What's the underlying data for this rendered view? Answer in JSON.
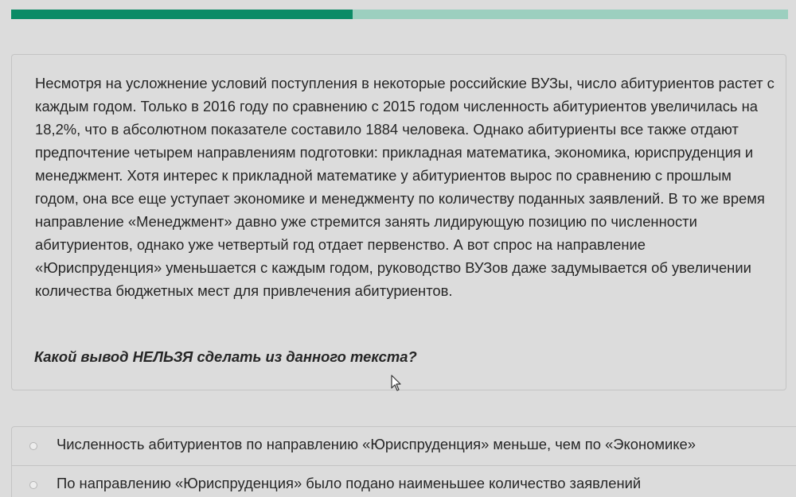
{
  "progress": {
    "fraction": 0.44,
    "fill_color": "#0b8b66",
    "track_color": "#9ccfbf"
  },
  "task": {
    "passage": "Несмотря на усложнение условий поступления в некоторые российские ВУЗы, число абитуриентов растет с каждым годом. Только в 2016 году по сравнению с 2015 годом численность абитуриентов увеличилась на 18,2%, что в абсолютном показателе составило 1884 человека. Однако абитуриенты все также отдают предпочтение четырем направлениям подготовки: прикладная математика, экономика, юриспруденция и менеджмент. Хотя интерес к прикладной математике у абитуриентов вырос по сравнению с прошлым годом, она все еще уступает экономике и менеджменту по количеству поданных заявлений. В то же время направление «Менеджмент» давно уже стремится занять лидирующую позицию по численности абитуриентов, однако уже четвертый год отдает первенство. А вот спрос на направление «Юриспруденция» уменьшается с каждым годом, руководство ВУЗов даже задумывается об увеличении количества бюджетных мест для привлечения абитуриентов.",
    "question": "Какой вывод НЕЛЬЗЯ сделать из данного текста?"
  },
  "options": [
    {
      "label": "Численность абитуриентов по направлению «Юриспруденция» меньше, чем по «Экономике»"
    },
    {
      "label": "По направлению «Юриспруденция» было подано наименьшее количество заявлений"
    }
  ]
}
